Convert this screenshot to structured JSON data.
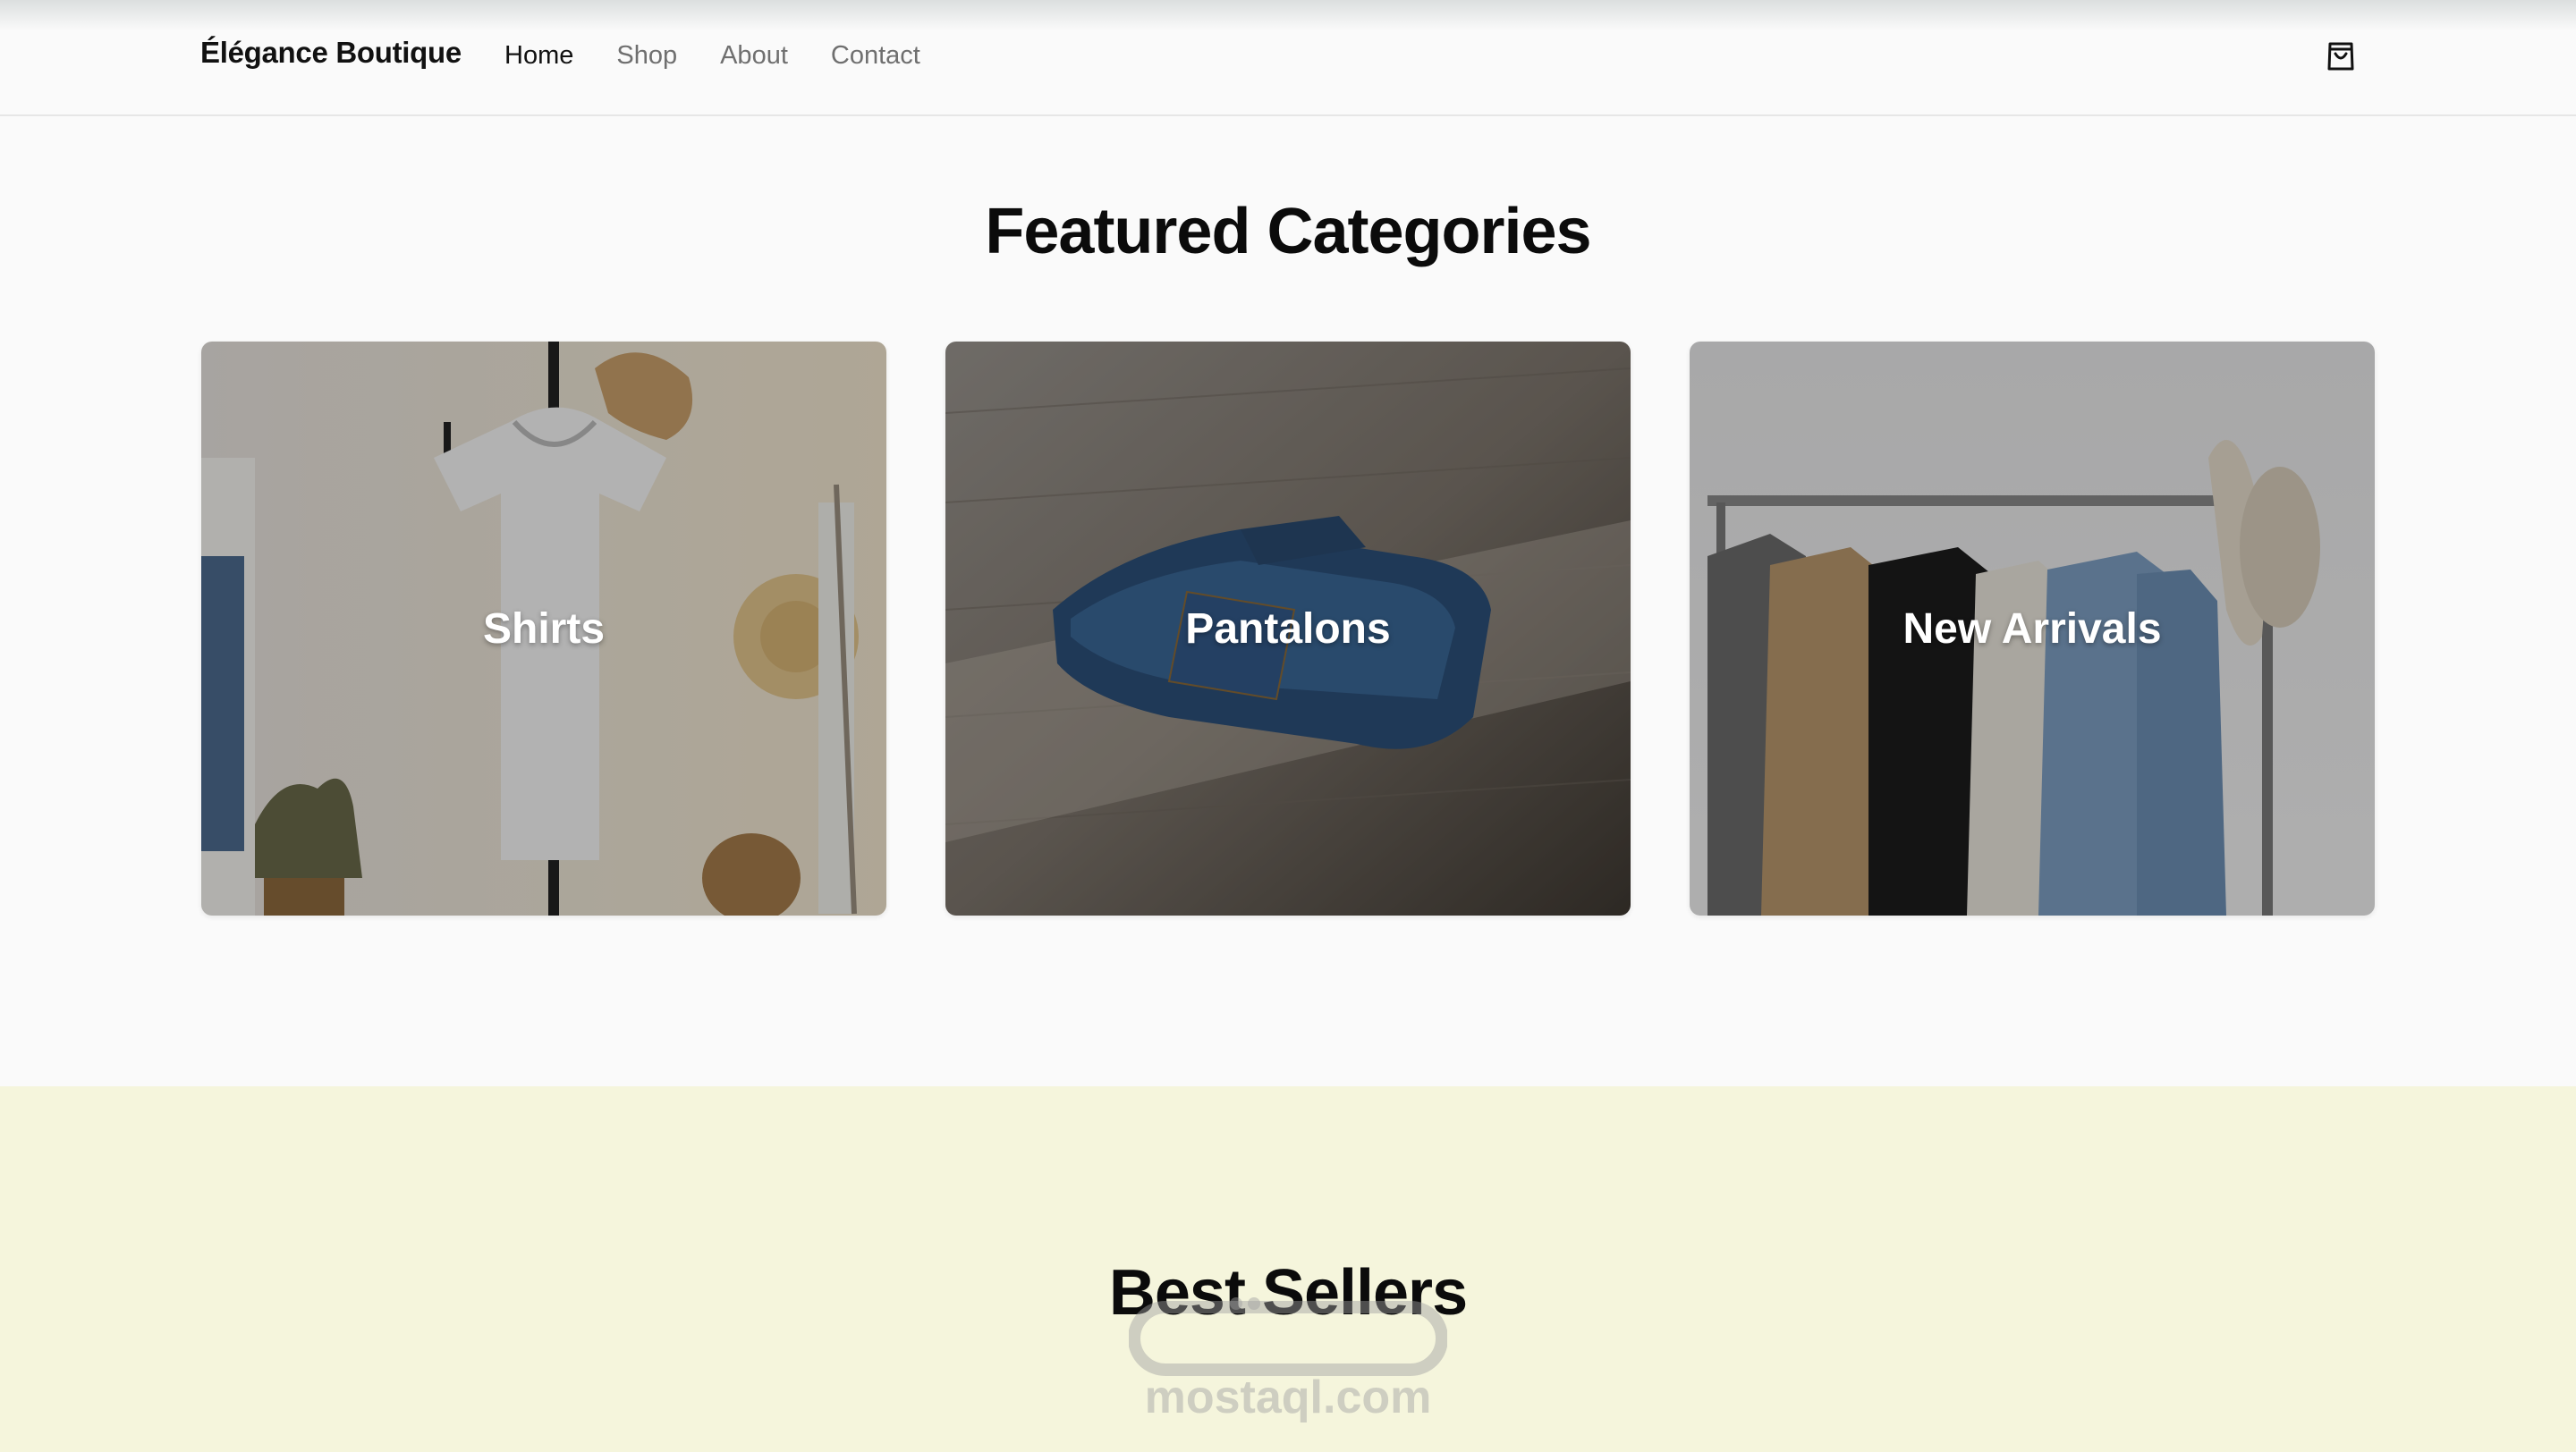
{
  "brand": {
    "name": "Élégance Boutique"
  },
  "nav": {
    "links": [
      {
        "label": "Home",
        "active": true
      },
      {
        "label": "Shop",
        "active": false
      },
      {
        "label": "About",
        "active": false
      },
      {
        "label": "Contact",
        "active": false
      }
    ],
    "cart_icon": "shopping-bag-icon"
  },
  "featured": {
    "title": "Featured Categories",
    "categories": [
      {
        "label": "Shirts",
        "image": "white t-shirt on clothes stand with hats"
      },
      {
        "label": "Pantalons",
        "image": "folded blue jeans on wooden floor"
      },
      {
        "label": "New Arrivals",
        "image": "jackets on clothing rack"
      }
    ]
  },
  "best_sellers": {
    "title": "Best Sellers"
  },
  "watermark": {
    "text": "mostaql.com"
  },
  "colors": {
    "page_bg": "#fafafa",
    "best_sellers_bg": "#f5f5dc",
    "text_primary": "#0b0b0b",
    "nav_inactive": "#6f6f6f"
  }
}
